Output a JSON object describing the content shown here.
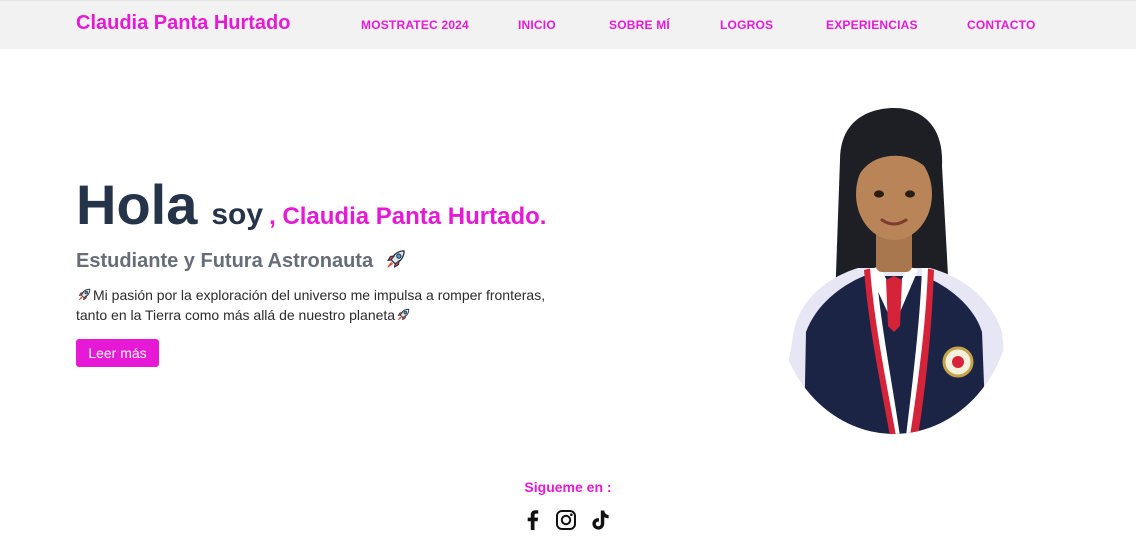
{
  "header": {
    "brand": "Claudia Panta Hurtado",
    "nav": [
      {
        "label": "MOSTRATEC 2024",
        "name": "nav-mostratec"
      },
      {
        "label": "INICIO",
        "name": "nav-inicio"
      },
      {
        "label": "SOBRE MÍ",
        "name": "nav-sobre-mi"
      },
      {
        "label": "LOGROS",
        "name": "nav-logros"
      },
      {
        "label": "EXPERIENCIAS",
        "name": "nav-experiencias"
      },
      {
        "label": "CONTACTO",
        "name": "nav-contacto"
      }
    ]
  },
  "hero": {
    "greeting": "Hola",
    "soy": "soy",
    "name": ", Claudia Panta Hurtado.",
    "subtitle": "Estudiante y Futura Astronauta",
    "description": "Mi pasión por la exploración del universo me impulsa a romper fronteras, tanto en la Tierra como más allá de nuestro planeta",
    "button_label": "Leer más"
  },
  "footer": {
    "follow_label": "Sigueme en :",
    "socials": [
      "facebook-icon",
      "instagram-icon",
      "tiktok-icon"
    ]
  },
  "colors": {
    "accent": "#e619d6",
    "heading": "#263449",
    "subtitle": "#666d79",
    "navbar": "#f2f2f2"
  }
}
